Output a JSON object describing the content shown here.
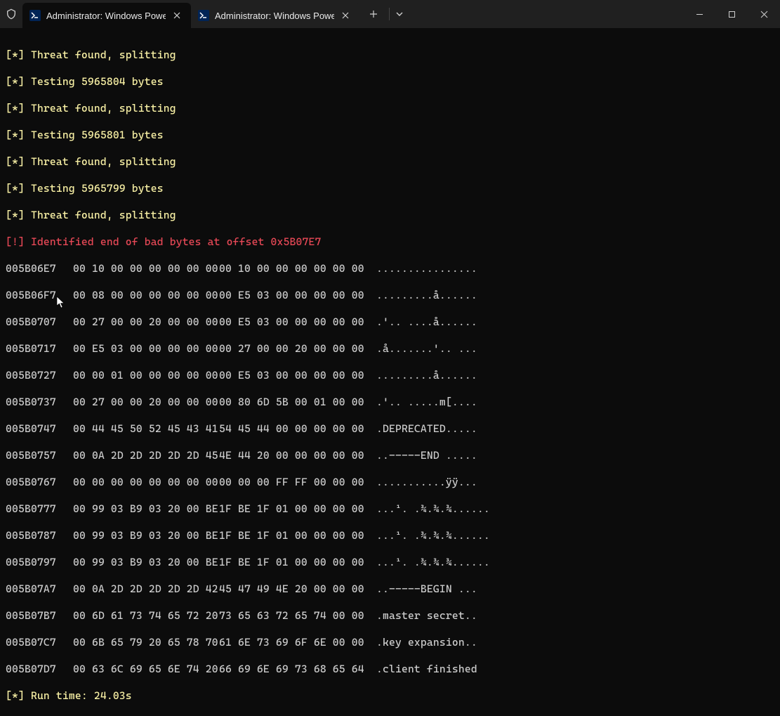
{
  "window": {
    "tabs": [
      {
        "title": "Administrator: Windows Powe",
        "active": true
      },
      {
        "title": "Administrator: Windows Power",
        "active": false
      }
    ]
  },
  "log_lines": [
    {
      "style": "yellow",
      "text": "[*] Threat found, splitting"
    },
    {
      "style": "yellow",
      "text": "[*] Testing 5965804 bytes"
    },
    {
      "style": "yellow",
      "text": "[*] Threat found, splitting"
    },
    {
      "style": "yellow",
      "text": "[*] Testing 5965801 bytes"
    },
    {
      "style": "yellow",
      "text": "[*] Threat found, splitting"
    },
    {
      "style": "yellow",
      "text": "[*] Testing 5965799 bytes"
    },
    {
      "style": "yellow",
      "text": "[*] Threat found, splitting"
    },
    {
      "style": "red",
      "text": "[!] Identified end of bad bytes at offset 0x5B07E7"
    }
  ],
  "hex_dump": [
    {
      "addr": "005B06E7",
      "g1": "00 10 00 00 00 00 00 00",
      "g2": "00 10 00 00 00 00 00 00",
      "ascii": "................"
    },
    {
      "addr": "005B06F7",
      "g1": "00 08 00 00 00 00 00 00",
      "g2": "00 E5 03 00 00 00 00 00",
      "ascii": ".........å......"
    },
    {
      "addr": "005B0707",
      "g1": "00 27 00 00 20 00 00 00",
      "g2": "00 E5 03 00 00 00 00 00",
      "ascii": ".'.. ....å......"
    },
    {
      "addr": "005B0717",
      "g1": "00 E5 03 00 00 00 00 00",
      "g2": "00 27 00 00 20 00 00 00",
      "ascii": ".å.......'.. ..."
    },
    {
      "addr": "005B0727",
      "g1": "00 00 01 00 00 00 00 00",
      "g2": "00 E5 03 00 00 00 00 00",
      "ascii": ".........å......"
    },
    {
      "addr": "005B0737",
      "g1": "00 27 00 00 20 00 00 00",
      "g2": "00 80 6D 5B 00 01 00 00",
      "ascii": ".'.. .....m[...."
    },
    {
      "addr": "005B0747",
      "g1": "00 44 45 50 52 45 43 41",
      "g2": "54 45 44 00 00 00 00 00",
      "ascii": ".DEPRECATED....."
    },
    {
      "addr": "005B0757",
      "g1": "00 0A 2D 2D 2D 2D 2D 45",
      "g2": "4E 44 20 00 00 00 00 00",
      "ascii": "..-----END ....."
    },
    {
      "addr": "005B0767",
      "g1": "00 00 00 00 00 00 00 00",
      "g2": "00 00 00 FF FF 00 00 00",
      "ascii": "...........ÿÿ..."
    },
    {
      "addr": "005B0777",
      "g1": "00 99 03 B9 03 20 00 BE",
      "g2": "1F BE 1F 01 00 00 00 00",
      "ascii": "...¹. .¾.¾.¾......"
    },
    {
      "addr": "005B0787",
      "g1": "00 99 03 B9 03 20 00 BE",
      "g2": "1F BE 1F 01 00 00 00 00",
      "ascii": "...¹. .¾.¾.¾......"
    },
    {
      "addr": "005B0797",
      "g1": "00 99 03 B9 03 20 00 BE",
      "g2": "1F BE 1F 01 00 00 00 00",
      "ascii": "...¹. .¾.¾.¾......"
    },
    {
      "addr": "005B07A7",
      "g1": "00 0A 2D 2D 2D 2D 2D 42",
      "g2": "45 47 49 4E 20 00 00 00",
      "ascii": "..-----BEGIN ..."
    },
    {
      "addr": "005B07B7",
      "g1": "00 6D 61 73 74 65 72 20",
      "g2": "73 65 63 72 65 74 00 00",
      "ascii": ".master secret.."
    },
    {
      "addr": "005B07C7",
      "g1": "00 6B 65 79 20 65 78 70",
      "g2": "61 6E 73 69 6F 6E 00 00",
      "ascii": ".key expansion.."
    },
    {
      "addr": "005B07D7",
      "g1": "00 63 6C 69 65 6E 74 20",
      "g2": "66 69 6E 69 73 68 65 64",
      "ascii": ".client finished"
    }
  ],
  "footer": {
    "style": "yellow",
    "text": "[*] Run time: 24.03s"
  }
}
